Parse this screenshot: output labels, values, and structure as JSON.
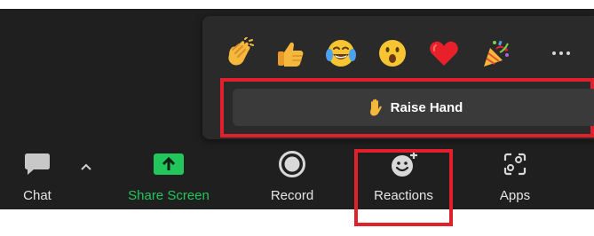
{
  "reactions_popup": {
    "emojis": [
      {
        "icon": "clapping-hands-icon"
      },
      {
        "icon": "thumbs-up-icon"
      },
      {
        "icon": "tears-of-joy-icon"
      },
      {
        "icon": "surprised-face-icon"
      },
      {
        "icon": "red-heart-icon"
      },
      {
        "icon": "party-popper-icon"
      }
    ],
    "more_icon": "more-ellipsis-icon",
    "raise_hand": {
      "icon": "raised-hand-icon",
      "label": "Raise Hand"
    }
  },
  "toolbar": {
    "chat": {
      "label": "Chat",
      "icon": "chat-bubble-icon"
    },
    "chat_options_icon": "chevron-up-icon",
    "share_screen": {
      "label": "Share Screen",
      "icon": "share-screen-icon"
    },
    "record": {
      "label": "Record",
      "icon": "record-icon"
    },
    "reactions": {
      "label": "Reactions",
      "icon": "emoji-add-icon"
    },
    "apps": {
      "label": "Apps",
      "icon": "apps-icon"
    }
  },
  "colors": {
    "background": "#1f1f1f",
    "popup": "#2a2a2a",
    "raise_hand_button": "#3a3a3a",
    "share_green": "#22c65b",
    "highlight_red": "#e0202a"
  }
}
